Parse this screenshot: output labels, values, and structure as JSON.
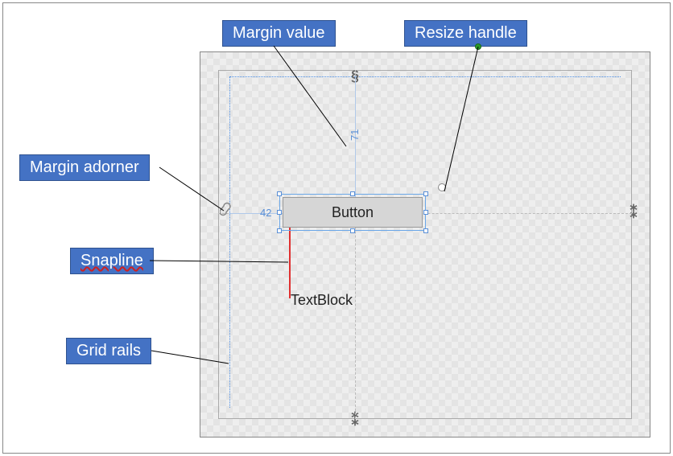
{
  "callouts": {
    "margin_value": "Margin value",
    "resize_handle": "Resize handle",
    "margin_adorner": "Margin adorner",
    "snapline": "Snapline",
    "grid_rails": "Grid rails"
  },
  "controls": {
    "button_label": "Button",
    "textblock_label": "TextBlock"
  },
  "margins": {
    "left_value": "42",
    "top_value": "71"
  },
  "colors": {
    "callout_fill": "#4472C4",
    "callout_border": "#2f528f",
    "snapline": "#e03030",
    "rail": "#4a8ee6"
  }
}
